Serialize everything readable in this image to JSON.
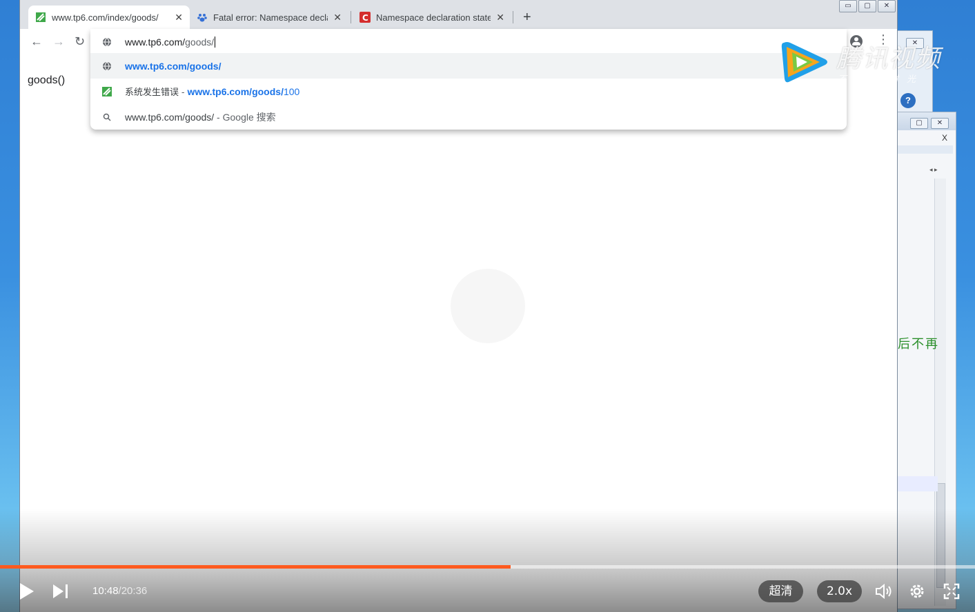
{
  "browser": {
    "tabs": [
      {
        "title": "www.tp6.com/index/goods/",
        "active": true
      },
      {
        "title": "Fatal error: Namespace declar",
        "active": false
      },
      {
        "title": "Namespace declaration staten",
        "active": false
      }
    ],
    "omnibox": {
      "typed": "www.tp6.com/",
      "autocomplete": "goods/"
    },
    "suggestions": [
      {
        "url": "www.tp6.com/goods/"
      },
      {
        "title": "系统发生错误",
        "sep": " - ",
        "url_bold": "www.tp6.com/goods/",
        "url_rest": "100"
      },
      {
        "query": "www.tp6.com/goods/",
        "suffix": " - Google 搜索"
      }
    ],
    "page_text": "goods()"
  },
  "overlay": {
    "brand": "腾讯视频",
    "slogan": "不负好时光"
  },
  "background": {
    "window_text": "后不再"
  },
  "player": {
    "current_time": "10:48",
    "duration": "/20:36",
    "progress": 0.524,
    "quality": "超清",
    "speed": "2.0x"
  },
  "colors": {
    "accent": "#ff5a1f",
    "link_blue": "#1a73e8"
  }
}
